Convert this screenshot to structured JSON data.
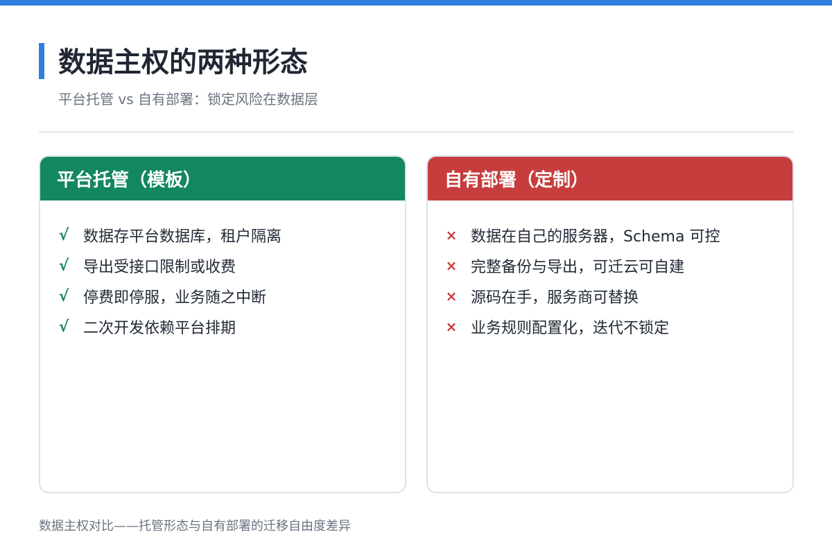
{
  "header": {
    "title": "数据主权的两种形态",
    "subtitle": "平台托管 vs 自有部署：锁定风险在数据层"
  },
  "colors": {
    "accent": "#2f7fe0",
    "hosted": "#13875f",
    "self_hosted": "#c73d3d"
  },
  "cards": {
    "hosted": {
      "title": "平台托管（模板）",
      "marker": "√",
      "marker_icon": "check-icon",
      "items": [
        "数据存平台数据库，租户隔离",
        "导出受接口限制或收费",
        "停费即停服，业务随之中断",
        "二次开发依赖平台排期"
      ]
    },
    "self_hosted": {
      "title": "自有部署（定制）",
      "marker": "×",
      "marker_icon": "cross-icon",
      "items": [
        "数据在自己的服务器，Schema 可控",
        "完整备份与导出，可迁云可自建",
        "源码在手，服务商可替换",
        "业务规则配置化，迭代不锁定"
      ]
    }
  },
  "caption": "数据主权对比——托管形态与自有部署的迁移自由度差异"
}
